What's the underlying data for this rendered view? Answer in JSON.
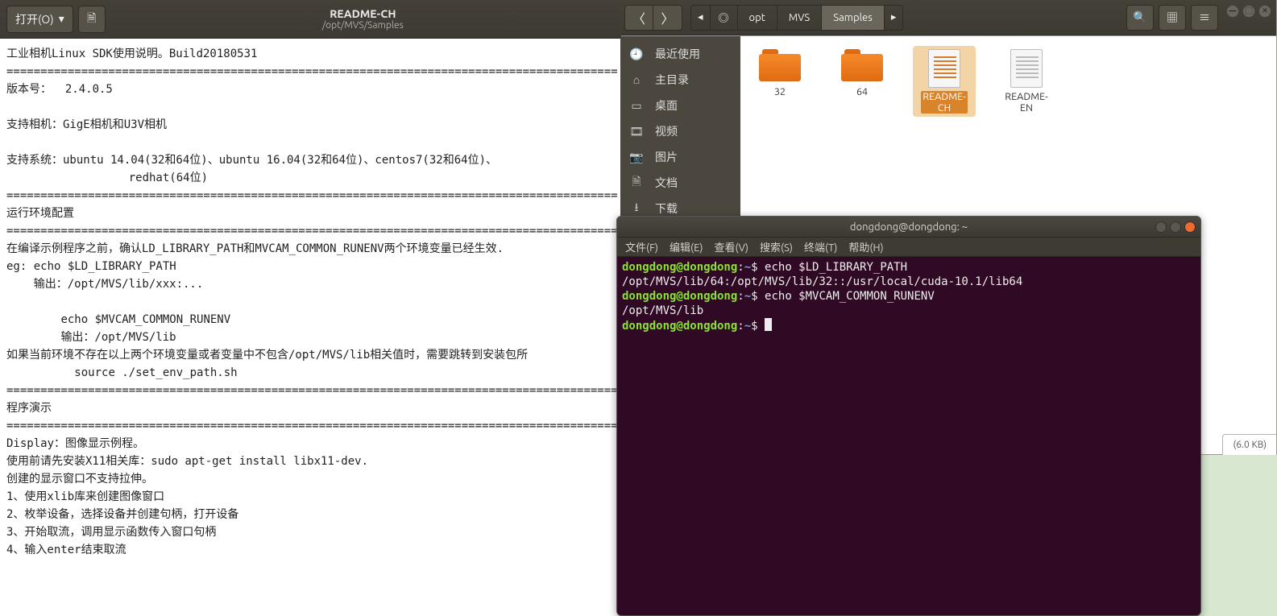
{
  "gedit": {
    "open_label": "打开(O)",
    "title": "README-CH",
    "subtitle": "/opt/MVS/Samples",
    "text": "工业相机Linux SDK使用说明。Build20180531\n==========================================================================================\n版本号：  2.4.0.5\n\n支持相机：GigE相机和U3V相机\n\n支持系统：ubuntu 14.04(32和64位)、ubuntu 16.04(32和64位)、centos7(32和64位)、\n                  redhat(64位)\n==========================================================================================\n运行环境配置\n==========================================================================================\n在编译示例程序之前，确认LD_LIBRARY_PATH和MVCAM_COMMON_RUNENV两个环境变量已经生效.\neg: echo $LD_LIBRARY_PATH\n    输出：/opt/MVS/lib/xxx:...\n\n        echo $MVCAM_COMMON_RUNENV\n        输出：/opt/MVS/lib\n如果当前环境不存在以上两个环境变量或者变量中不包含/opt/MVS/lib相关值时，需要跳转到安装包所\n          source ./set_env_path.sh\n==========================================================================================\n程序演示\n==========================================================================================\nDisplay：图像显示例程。\n使用前请先安装X11相关库：sudo apt-get install libx11-dev.\n创建的显示窗口不支持拉伸。\n1、使用xlib库来创建图像窗口\n2、枚举设备，选择设备并创建句柄，打开设备\n3、开始取流，调用显示函数传入窗口句柄\n4、输入enter结束取流"
  },
  "nautilus": {
    "path": {
      "seg1": "opt",
      "seg2": "MVS",
      "seg3": "Samples"
    },
    "sidebar": {
      "recent": "最近使用",
      "home": "主目录",
      "desktop": "桌面",
      "videos": "视频",
      "pictures": "图片",
      "documents": "文档",
      "downloads": "下载"
    },
    "files": {
      "f32": "32",
      "f64": "64",
      "fch1": "README-",
      "fch2": "CH",
      "fen1": "README-",
      "fen2": "EN"
    },
    "status": "(6.0 KB)"
  },
  "terminal": {
    "title": "dongdong@dongdong: ~",
    "menu": {
      "file": "文件(F)",
      "edit": "编辑(E)",
      "view": "查看(V)",
      "search": "搜索(S)",
      "terminal": "终端(T)",
      "help": "帮助(H)"
    },
    "prompt_user": "dongdong@dongdong",
    "prompt_sep": ":",
    "prompt_path": "~",
    "prompt_dollar": "$ ",
    "cmd1": "echo $LD_LIBRARY_PATH",
    "out1": "/opt/MVS/lib/64:/opt/MVS/lib/32::/usr/local/cuda-10.1/lib64",
    "cmd2": "echo $MVCAM_COMMON_RUNENV",
    "out2": "/opt/MVS/lib"
  }
}
